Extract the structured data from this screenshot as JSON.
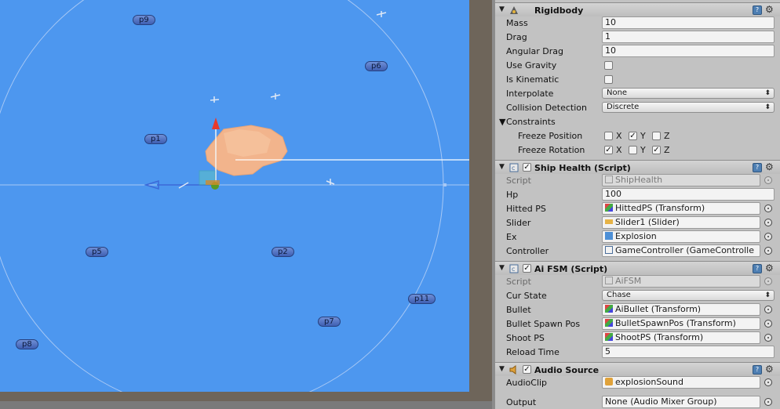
{
  "scene": {
    "waypoints": [
      {
        "id": "p9",
        "label": "p9"
      },
      {
        "id": "p6",
        "label": "p6"
      },
      {
        "id": "p1",
        "label": "p1"
      },
      {
        "id": "p5",
        "label": "p5"
      },
      {
        "id": "p2",
        "label": "p2"
      },
      {
        "id": "p11",
        "label": "p11"
      },
      {
        "id": "p7",
        "label": "p7"
      },
      {
        "id": "p8",
        "label": "p8"
      }
    ]
  },
  "inspector": {
    "rigidbody": {
      "title": "Rigidbody",
      "mass_label": "Mass",
      "mass": "10",
      "drag_label": "Drag",
      "drag": "1",
      "angular_drag_label": "Angular Drag",
      "angular_drag": "10",
      "use_gravity_label": "Use Gravity",
      "use_gravity": false,
      "is_kinematic_label": "Is Kinematic",
      "is_kinematic": false,
      "interpolate_label": "Interpolate",
      "interpolate": "None",
      "collision_label": "Collision Detection",
      "collision": "Discrete",
      "constraints_label": "Constraints",
      "freeze_position_label": "Freeze Position",
      "freeze_rotation_label": "Freeze Rotation",
      "axis_x": "X",
      "axis_y": "Y",
      "axis_z": "Z",
      "freeze_position": {
        "x": false,
        "y": true,
        "z": false
      },
      "freeze_rotation": {
        "x": true,
        "y": false,
        "z": true
      }
    },
    "ship_health": {
      "title": "Ship Health (Script)",
      "script_label": "Script",
      "script": "ShipHealth",
      "hp_label": "Hp",
      "hp": "100",
      "hitted_label": "Hitted PS",
      "hitted": "HittedPS (Transform)",
      "slider_label": "Slider",
      "slider": "Slider1 (Slider)",
      "ex_label": "Ex",
      "ex": "Explosion",
      "controller_label": "Controller",
      "controller": "GameController (GameControlle"
    },
    "ai_fsm": {
      "title": "Ai FSM (Script)",
      "script_label": "Script",
      "script": "AiFSM",
      "cur_state_label": "Cur State",
      "cur_state": "Chase",
      "bullet_label": "Bullet",
      "bullet": "AiBullet (Transform)",
      "spawn_label": "Bullet Spawn Pos",
      "spawn": "BulletSpawnPos (Transform)",
      "shoot_label": "Shoot PS",
      "shoot": "ShootPS (Transform)",
      "reload_label": "Reload Time",
      "reload": "5"
    },
    "audio_source": {
      "title": "Audio Source",
      "clip_label": "AudioClip",
      "clip": "explosionSound",
      "output_label": "Output",
      "output": "None (Audio Mixer Group)"
    }
  },
  "colors": {
    "water": "#4d97ef",
    "inspector_bg": "#c2c2c2",
    "boat": "#f2b48c"
  }
}
